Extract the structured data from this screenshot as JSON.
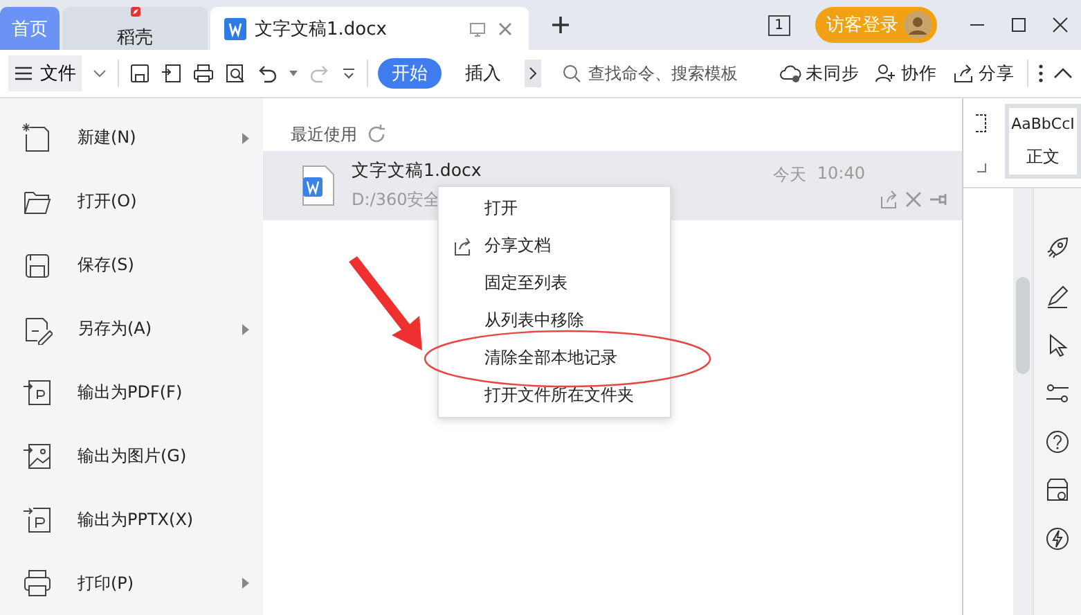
{
  "tabs": [
    {
      "label": "首页",
      "kind": "home",
      "selected": false
    },
    {
      "label": "稻壳",
      "kind": "app",
      "selected": false
    },
    {
      "label": "文字文稿1.docx",
      "kind": "document",
      "selected": true
    }
  ],
  "title_bar": {
    "window_count": "1",
    "login_button": "访客登录"
  },
  "toolbar": {
    "file_menu": "文件",
    "ribbon_tabs": [
      {
        "label": "开始",
        "selected": true
      },
      {
        "label": "插入",
        "selected": false
      }
    ],
    "search": {
      "placeholder": "查找命令、搜索模板"
    },
    "actions": [
      {
        "label": "未同步",
        "kind": "cloud"
      },
      {
        "label": "协作",
        "kind": "collab"
      },
      {
        "label": "分享",
        "kind": "share"
      }
    ]
  },
  "file_menu": [
    {
      "label": "新建(N)",
      "kind": "new",
      "has_submenu": true
    },
    {
      "label": "打开(O)",
      "kind": "open",
      "has_submenu": false
    },
    {
      "label": "保存(S)",
      "kind": "save",
      "has_submenu": false
    },
    {
      "label": "另存为(A)",
      "kind": "saveas",
      "has_submenu": true
    },
    {
      "label": "输出为PDF(F)",
      "kind": "pdf",
      "has_submenu": false
    },
    {
      "label": "输出为图片(G)",
      "kind": "image",
      "has_submenu": false
    },
    {
      "label": "输出为PPTX(X)",
      "kind": "pptx",
      "has_submenu": false
    },
    {
      "label": "打印(P)",
      "kind": "print",
      "has_submenu": true
    }
  ],
  "recent": {
    "heading": "最近使用",
    "files": [
      {
        "name": "文字文稿1.docx",
        "path": "D:/360安全",
        "date": "今天",
        "time": "10:40",
        "selected": true
      }
    ]
  },
  "context_menu": [
    {
      "label": "打开",
      "kind": "plain",
      "circled": false
    },
    {
      "label": "分享文档",
      "kind": "share",
      "circled": false
    },
    {
      "label": "固定至列表",
      "kind": "plain",
      "circled": false
    },
    {
      "label": "从列表中移除",
      "kind": "plain",
      "circled": false
    },
    {
      "label": "清除全部本地记录",
      "kind": "plain",
      "circled": true
    },
    {
      "label": "打开文件所在文件夹",
      "kind": "plain",
      "circled": false
    }
  ],
  "style_gallery": {
    "sample": "AaBbCcI",
    "style_name": "正文"
  }
}
